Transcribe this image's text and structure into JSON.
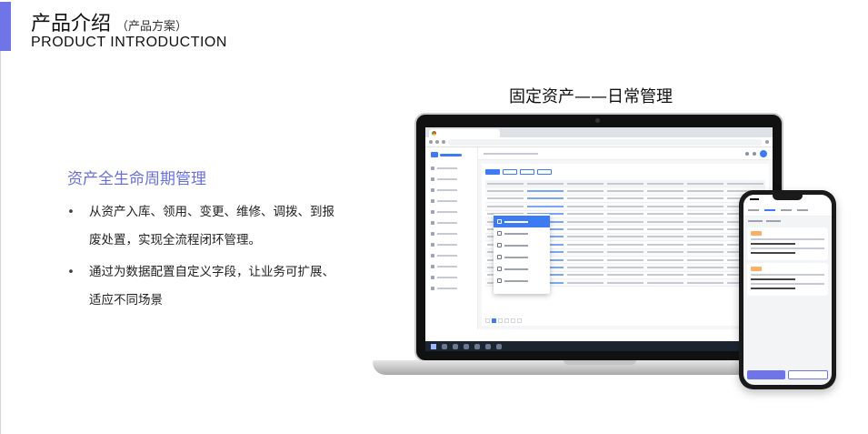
{
  "header": {
    "title_cn": "产品介绍",
    "subtitle_cn": "（产品方案）",
    "title_en": "PRODUCT INTRODUCTION"
  },
  "feature": {
    "title": "资产全生命周期管理",
    "bullets": [
      "从资产入库、领用、变更、维修、调拨、到报废处置，实现全流程闭环管理。",
      "通过为数据配置自定义字段，让业务可扩展、适应不同场景"
    ]
  },
  "showcase": {
    "title": "固定资产——日常管理"
  },
  "colors": {
    "accent": "#6f74e6",
    "app_primary": "#3d7bf2",
    "badge": "#f7b267"
  }
}
